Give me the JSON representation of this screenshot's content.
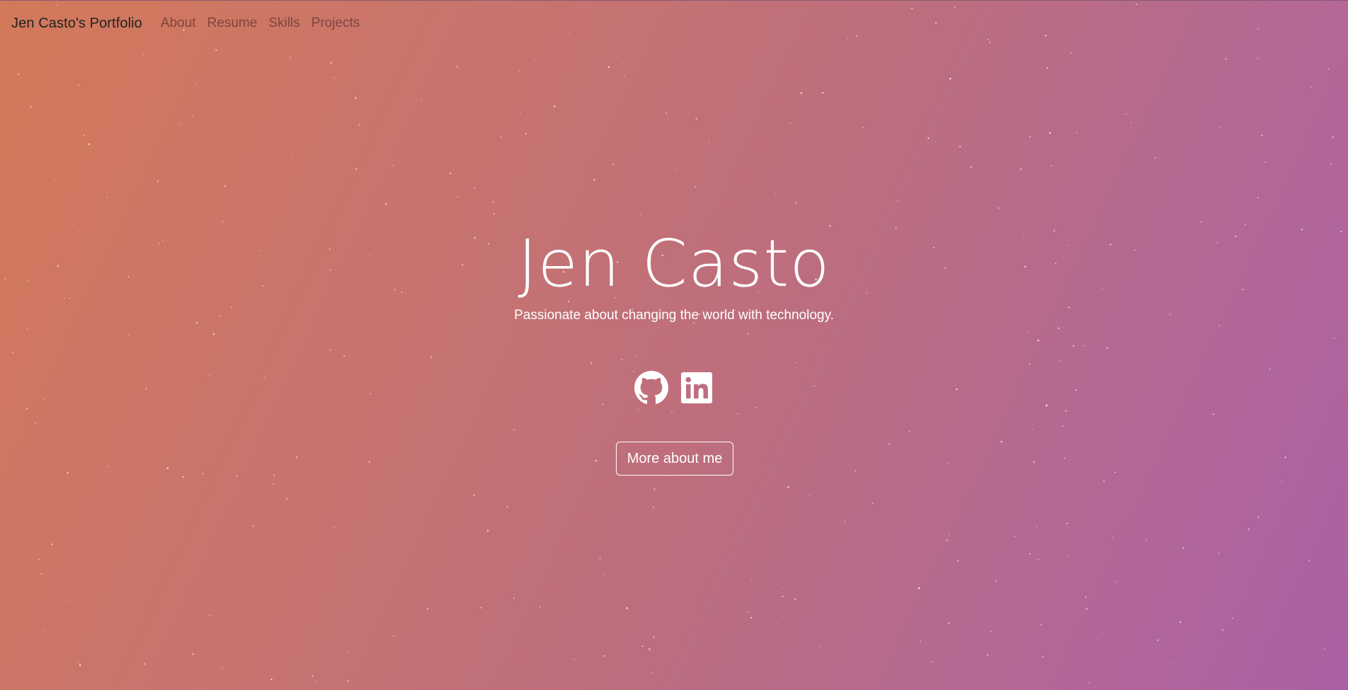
{
  "nav": {
    "brand": "Jen Casto's Portfolio",
    "links": [
      {
        "label": "About"
      },
      {
        "label": "Resume"
      },
      {
        "label": "Skills"
      },
      {
        "label": "Projects"
      }
    ]
  },
  "hero": {
    "title": "Jen Casto",
    "subtitle": "Passionate about changing the world with technology.",
    "socials": [
      {
        "icon": "github-icon"
      },
      {
        "icon": "linkedin-icon"
      }
    ],
    "cta_label": "More about me"
  },
  "colors": {
    "gradient_start": "#d3795a",
    "gradient_end": "#a960a4",
    "text": "#ffffff",
    "brand_text": "#222222"
  }
}
